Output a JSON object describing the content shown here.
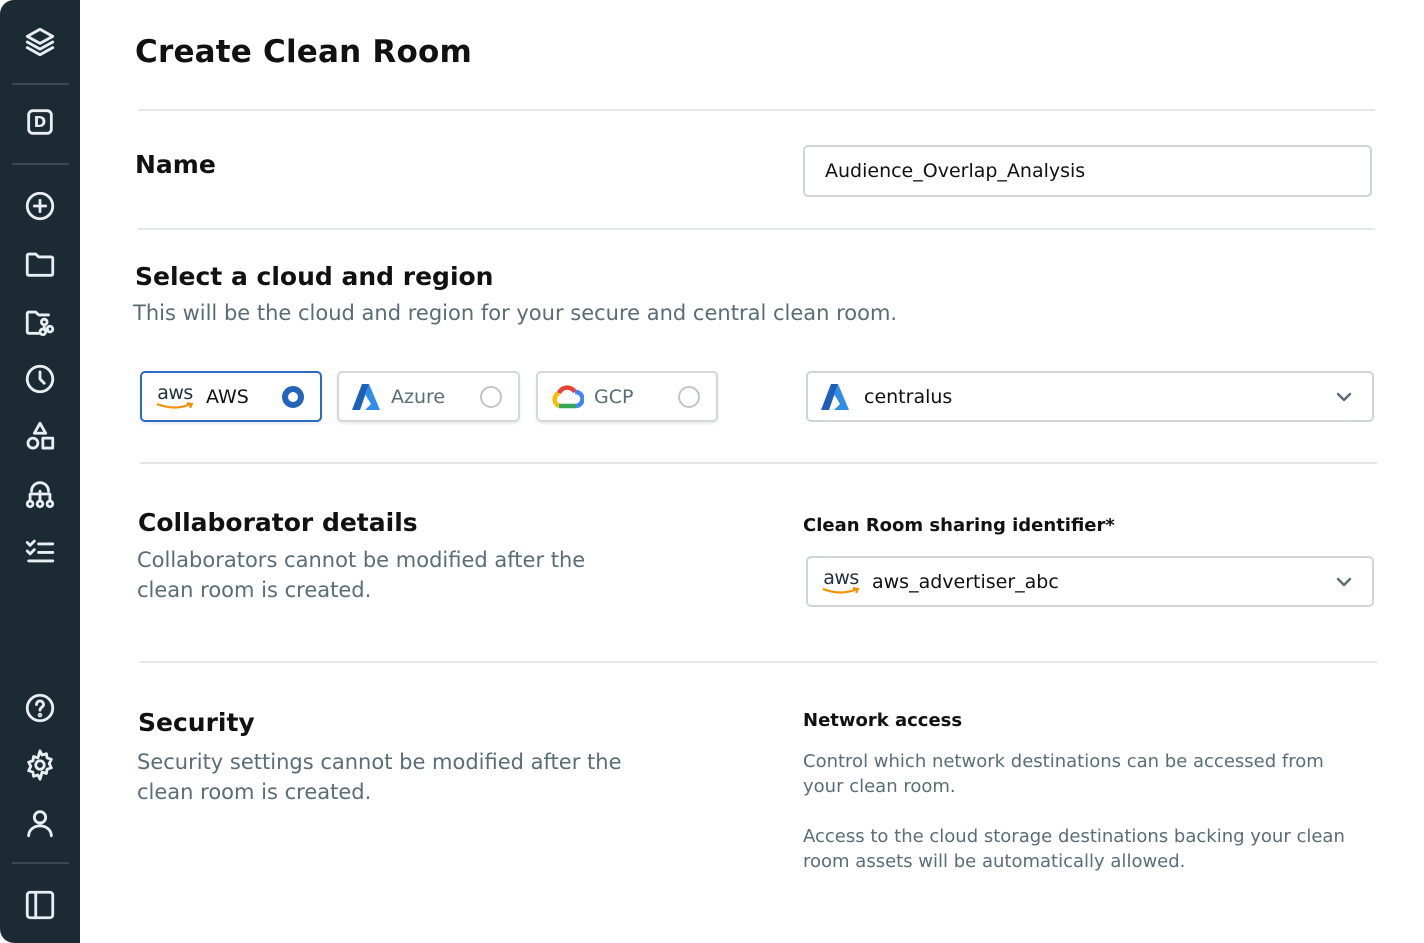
{
  "page": {
    "title": "Create Clean Room"
  },
  "sidebar": {
    "logo_icon": "layers-icon",
    "workspace_letter": "D",
    "icons": [
      "plus-circle-icon",
      "folder-icon",
      "shared-folder-icon",
      "history-icon",
      "shapes-icon",
      "hierarchy-icon",
      "checklist-icon",
      "help-icon",
      "settings-icon",
      "user-icon",
      "panel-toggle-icon"
    ]
  },
  "name_section": {
    "heading": "Name",
    "value": "Audience_Overlap_Analysis"
  },
  "cloud_section": {
    "heading": "Select a cloud and region",
    "subtitle": "This will be the cloud and region for your secure and central clean room.",
    "options": [
      {
        "logo_text": "aws",
        "label": "AWS",
        "selected": true
      },
      {
        "label": "Azure",
        "selected": false
      },
      {
        "label": "GCP",
        "selected": false
      }
    ],
    "region": {
      "value": "centralus",
      "icon": "azure-icon"
    }
  },
  "collaborator_section": {
    "heading": "Collaborator details",
    "subtitle_line1": "Collaborators cannot be modified after the",
    "subtitle_line2": "clean room is created.",
    "field_label": "Clean Room sharing identifier*",
    "identifier": {
      "logo_text": "aws",
      "value": "aws_advertiser_abc"
    }
  },
  "security_section": {
    "heading": "Security",
    "subtitle_line1": "Security settings cannot be modified after the",
    "subtitle_line2": "clean room is created.",
    "network_label": "Network access",
    "para1_line1": "Control which network destinations can be accessed from",
    "para1_line2": "your clean room.",
    "para2_line1": "Access to the cloud storage destinations backing your clean",
    "para2_line2": "room assets will be automatically allowed."
  },
  "colors": {
    "sidebar_bg": "#1b2a33",
    "accent_blue": "#2266bb",
    "muted_text": "#5a6c76"
  }
}
